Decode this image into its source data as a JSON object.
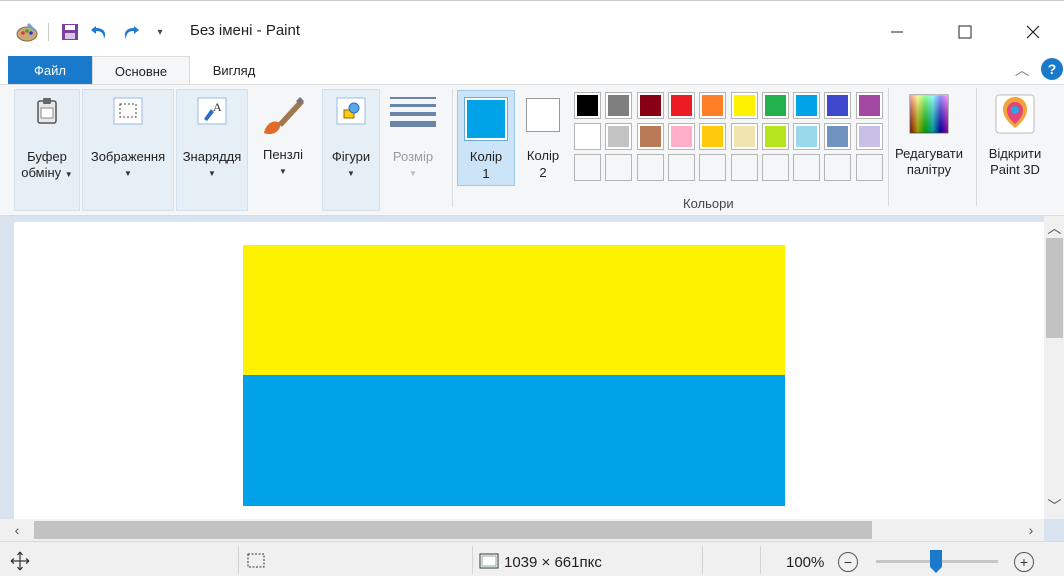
{
  "window": {
    "title": "Без імені - Paint",
    "minimize_icon": "minimize-icon",
    "maximize_icon": "maximize-icon",
    "close_icon": "close-icon"
  },
  "quick_access": {
    "icons": [
      "paint-app-icon",
      "save-icon",
      "undo-icon",
      "redo-icon",
      "customize-dropdown-icon"
    ]
  },
  "tabs": {
    "file": "Файл",
    "home": "Основне",
    "view": "Вигляд",
    "active": "Основне"
  },
  "ribbon": {
    "clipboard": {
      "line1": "Буфер",
      "line2": "обміну"
    },
    "image": {
      "label": "Зображення"
    },
    "tools": {
      "label": "Знаряддя"
    },
    "brushes": {
      "label": "Пензлі"
    },
    "shapes": {
      "label": "Фігури"
    },
    "size": {
      "label": "Розмір"
    },
    "color1": {
      "line1": "Колір",
      "line2": "1",
      "value": "#00a2e8"
    },
    "color2": {
      "line1": "Колір",
      "line2": "2",
      "value": "#ffffff"
    },
    "colors_group_label": "Кольори",
    "edit_colors": {
      "line1": "Редагувати",
      "line2": "палітру"
    },
    "open_3d": {
      "line1": "Відкрити",
      "line2": "Paint 3D"
    }
  },
  "palette": {
    "row1": [
      "#000000",
      "#7f7f7f",
      "#880015",
      "#ed1c24",
      "#ff7f27",
      "#fff200",
      "#22b14c",
      "#00a2e8",
      "#3f48cc",
      "#a349a4"
    ],
    "row2": [
      "#ffffff",
      "#c3c3c3",
      "#b97a57",
      "#ffaec9",
      "#ffc90e",
      "#efe4b0",
      "#b5e61d",
      "#99d9ea",
      "#7092be",
      "#c8bfe7"
    ],
    "row3": [
      "",
      "",
      "",
      "",
      "",
      "",
      "",
      "",
      "",
      ""
    ]
  },
  "canvas": {
    "top_color": "#fff200",
    "bottom_color": "#00a2e8"
  },
  "status": {
    "image_size": "1039 × 661пкс",
    "zoom": "100%",
    "zoom_level": 1.0
  }
}
